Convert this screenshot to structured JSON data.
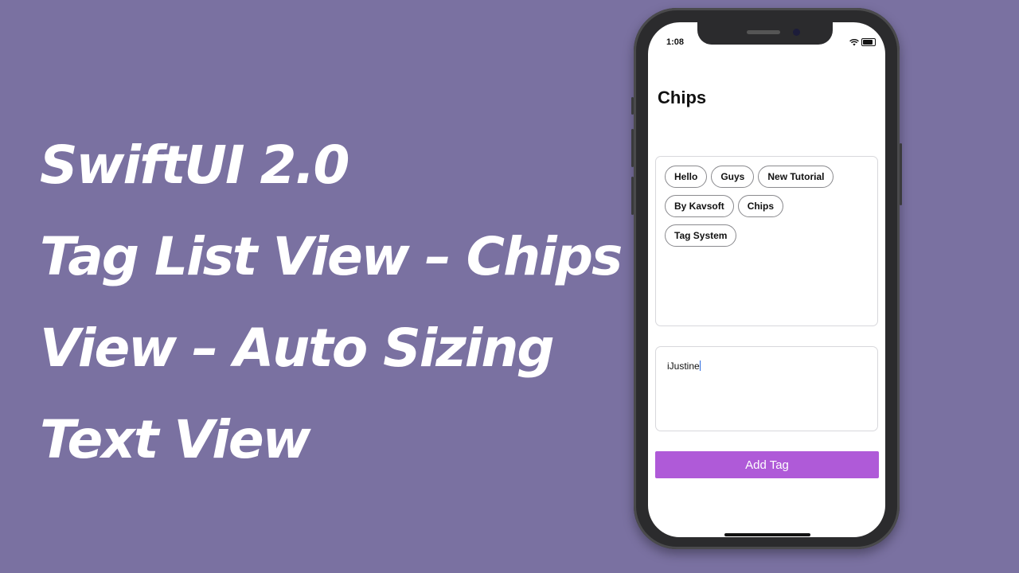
{
  "title": {
    "lines": [
      "SwiftUI 2.0",
      "Tag List View – Chips",
      "View – Auto Sizing",
      "Text View"
    ]
  },
  "status_bar": {
    "time": "1:08"
  },
  "app": {
    "nav_title": "Chips",
    "tags": [
      [
        "Hello",
        "Guys",
        "New Tutorial"
      ],
      [
        "By Kavsoft",
        "Chips"
      ],
      [
        "Tag System"
      ]
    ],
    "input_value": "iJustine",
    "add_button_label": "Add Tag"
  },
  "colors": {
    "background": "#7a71a1",
    "button": "#af5ad8"
  }
}
